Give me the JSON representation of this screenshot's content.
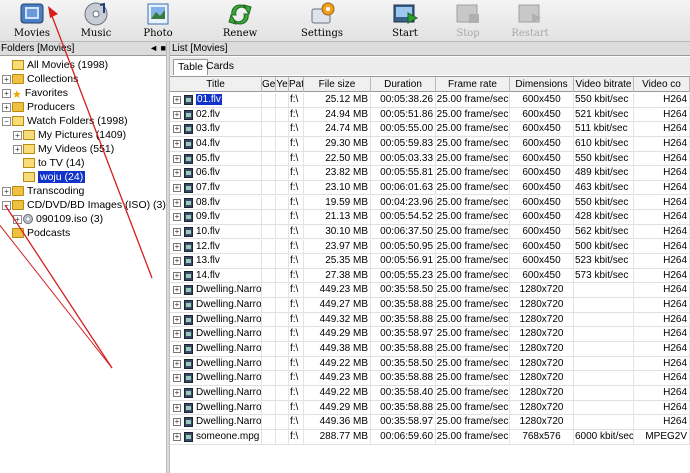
{
  "toolbar": {
    "buttons": [
      {
        "label": "Movies",
        "icon": "movies-icon"
      },
      {
        "label": "Music",
        "icon": "music-icon"
      },
      {
        "label": "Photo",
        "icon": "photo-icon"
      },
      {
        "label": "Renew",
        "icon": "renew-icon"
      },
      {
        "label": "Settings",
        "icon": "settings-icon"
      },
      {
        "label": "Start",
        "icon": "start-icon"
      },
      {
        "label": "Stop",
        "icon": "stop-icon",
        "disabled": true
      },
      {
        "label": "Restart",
        "icon": "restart-icon",
        "disabled": true
      }
    ]
  },
  "left_panel": {
    "title": "Folders [Movies]",
    "controls": "◄ ■",
    "tree": [
      {
        "label": "All Movies (1998)",
        "expander": "",
        "icon": "folder-open-icon"
      },
      {
        "label": "Collections",
        "expander": "+",
        "icon": "folder-icon"
      },
      {
        "label": "Favorites",
        "expander": "+",
        "icon": "star-icon"
      },
      {
        "label": "Producers",
        "expander": "+",
        "icon": "folder-icon"
      },
      {
        "label": "Watch Folders (1998)",
        "expander": "−",
        "icon": "folder-open-icon"
      },
      {
        "label": "My Pictures (1409)",
        "expander": "+",
        "icon": "folder-open-icon"
      },
      {
        "label": "My Videos (551)",
        "expander": "+",
        "icon": "folder-open-icon"
      },
      {
        "label": "to TV (14)",
        "expander": "",
        "icon": "folder-open-icon"
      },
      {
        "label": "woju (24)",
        "expander": "",
        "icon": "folder-open-icon",
        "selected": true
      },
      {
        "label": "Transcoding",
        "expander": "+",
        "icon": "folder-icon"
      },
      {
        "label": "CD/DVD/BD Images (ISO) (3)",
        "expander": "−",
        "icon": "folder-icon"
      },
      {
        "label": "090109.iso (3)",
        "expander": "+",
        "icon": "disc-icon"
      },
      {
        "label": "Podcasts",
        "expander": "",
        "icon": "folder-icon"
      }
    ]
  },
  "right_panel": {
    "title": "List [Movies]",
    "tabs": [
      "Table",
      "Cards"
    ],
    "active_tab": "Table",
    "columns": [
      "Title",
      "Ge",
      "Ye",
      "Pat",
      "File size",
      "Duration",
      "Frame rate",
      "Dimensions",
      "Video bitrate",
      "Video co"
    ],
    "rows": [
      {
        "title": "01.flv",
        "path": "f:\\",
        "size": "25.12 MB",
        "duration": "00:05:38.26",
        "fps": "25.00 frame/sec",
        "dim": "600x450",
        "bitrate": "550 kbit/sec",
        "codec": "H264",
        "selected": true
      },
      {
        "title": "02.flv",
        "path": "f:\\",
        "size": "24.94 MB",
        "duration": "00:05:51.86",
        "fps": "25.00 frame/sec",
        "dim": "600x450",
        "bitrate": "521 kbit/sec",
        "codec": "H264"
      },
      {
        "title": "03.flv",
        "path": "f:\\",
        "size": "24.74 MB",
        "duration": "00:05:55.00",
        "fps": "25.00 frame/sec",
        "dim": "600x450",
        "bitrate": "511 kbit/sec",
        "codec": "H264"
      },
      {
        "title": "04.flv",
        "path": "f:\\",
        "size": "29.30 MB",
        "duration": "00:05:59.83",
        "fps": "25.00 frame/sec",
        "dim": "600x450",
        "bitrate": "610 kbit/sec",
        "codec": "H264"
      },
      {
        "title": "05.flv",
        "path": "f:\\",
        "size": "22.50 MB",
        "duration": "00:05:03.33",
        "fps": "25.00 frame/sec",
        "dim": "600x450",
        "bitrate": "550 kbit/sec",
        "codec": "H264"
      },
      {
        "title": "06.flv",
        "path": "f:\\",
        "size": "23.82 MB",
        "duration": "00:05:55.81",
        "fps": "25.00 frame/sec",
        "dim": "600x450",
        "bitrate": "489 kbit/sec",
        "codec": "H264"
      },
      {
        "title": "07.flv",
        "path": "f:\\",
        "size": "23.10 MB",
        "duration": "00:06:01.63",
        "fps": "25.00 frame/sec",
        "dim": "600x450",
        "bitrate": "463 kbit/sec",
        "codec": "H264"
      },
      {
        "title": "08.flv",
        "path": "f:\\",
        "size": "19.59 MB",
        "duration": "00:04:23.96",
        "fps": "25.00 frame/sec",
        "dim": "600x450",
        "bitrate": "550 kbit/sec",
        "codec": "H264"
      },
      {
        "title": "09.flv",
        "path": "f:\\",
        "size": "21.13 MB",
        "duration": "00:05:54.52",
        "fps": "25.00 frame/sec",
        "dim": "600x450",
        "bitrate": "428 kbit/sec",
        "codec": "H264"
      },
      {
        "title": "10.flv",
        "path": "f:\\",
        "size": "30.10 MB",
        "duration": "00:06:37.50",
        "fps": "25.00 frame/sec",
        "dim": "600x450",
        "bitrate": "562 kbit/sec",
        "codec": "H264"
      },
      {
        "title": "12.flv",
        "path": "f:\\",
        "size": "23.97 MB",
        "duration": "00:05:50.95",
        "fps": "25.00 frame/sec",
        "dim": "600x450",
        "bitrate": "500 kbit/sec",
        "codec": "H264"
      },
      {
        "title": "13.flv",
        "path": "f:\\",
        "size": "25.35 MB",
        "duration": "00:05:56.91",
        "fps": "25.00 frame/sec",
        "dim": "600x450",
        "bitrate": "523 kbit/sec",
        "codec": "H264"
      },
      {
        "title": "14.flv",
        "path": "f:\\",
        "size": "27.38 MB",
        "duration": "00:05:55.23",
        "fps": "25.00 frame/sec",
        "dim": "600x450",
        "bitrate": "573 kbit/sec",
        "codec": "H264"
      },
      {
        "title": "Dwelling.Narrow",
        "path": "f:\\",
        "size": "449.23 MB",
        "duration": "00:35:58.50",
        "fps": "25.00 frame/sec",
        "dim": "1280x720",
        "bitrate": "",
        "codec": "H264"
      },
      {
        "title": "Dwelling.Narrow",
        "path": "f:\\",
        "size": "449.27 MB",
        "duration": "00:35:58.88",
        "fps": "25.00 frame/sec",
        "dim": "1280x720",
        "bitrate": "",
        "codec": "H264"
      },
      {
        "title": "Dwelling.Narrow",
        "path": "f:\\",
        "size": "449.32 MB",
        "duration": "00:35:58.88",
        "fps": "25.00 frame/sec",
        "dim": "1280x720",
        "bitrate": "",
        "codec": "H264"
      },
      {
        "title": "Dwelling.Narrow",
        "path": "f:\\",
        "size": "449.29 MB",
        "duration": "00:35:58.97",
        "fps": "25.00 frame/sec",
        "dim": "1280x720",
        "bitrate": "",
        "codec": "H264"
      },
      {
        "title": "Dwelling.Narrow",
        "path": "f:\\",
        "size": "449.38 MB",
        "duration": "00:35:58.88",
        "fps": "25.00 frame/sec",
        "dim": "1280x720",
        "bitrate": "",
        "codec": "H264"
      },
      {
        "title": "Dwelling.Narrow",
        "path": "f:\\",
        "size": "449.22 MB",
        "duration": "00:35:58.50",
        "fps": "25.00 frame/sec",
        "dim": "1280x720",
        "bitrate": "",
        "codec": "H264"
      },
      {
        "title": "Dwelling.Narrow",
        "path": "f:\\",
        "size": "449.23 MB",
        "duration": "00:35:58.88",
        "fps": "25.00 frame/sec",
        "dim": "1280x720",
        "bitrate": "",
        "codec": "H264"
      },
      {
        "title": "Dwelling.Narrow",
        "path": "f:\\",
        "size": "449.22 MB",
        "duration": "00:35:58.40",
        "fps": "25.00 frame/sec",
        "dim": "1280x720",
        "bitrate": "",
        "codec": "H264"
      },
      {
        "title": "Dwelling.Narrow",
        "path": "f:\\",
        "size": "449.29 MB",
        "duration": "00:35:58.88",
        "fps": "25.00 frame/sec",
        "dim": "1280x720",
        "bitrate": "",
        "codec": "H264"
      },
      {
        "title": "Dwelling.Narrow",
        "path": "f:\\",
        "size": "449.36 MB",
        "duration": "00:35:58.97",
        "fps": "25.00 frame/sec",
        "dim": "1280x720",
        "bitrate": "",
        "codec": "H264"
      },
      {
        "title": "someone.mpg",
        "path": "f:\\",
        "size": "288.77 MB",
        "duration": "00:06:59.60",
        "fps": "25.00 frame/sec",
        "dim": "768x576",
        "bitrate": "6000 kbit/sec",
        "codec": "MPEG2V"
      }
    ]
  },
  "colors": {
    "selection": "#1133cc",
    "annotation_arrow": "#d42020"
  }
}
